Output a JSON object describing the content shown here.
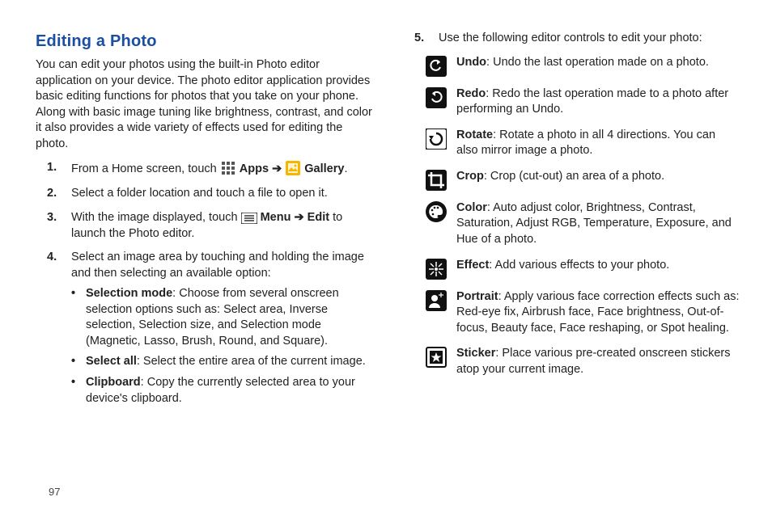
{
  "page_number": "97",
  "heading": "Editing a Photo",
  "intro": "You can edit your photos using the built-in Photo editor application on your device. The photo editor application provides basic editing functions for photos that you take on your phone. Along with basic image tuning like brightness, contrast, and color it also provides a wide variety of effects used for editing the photo.",
  "step1_pre": "From a Home screen, touch ",
  "step1_apps": "Apps",
  "step1_arrow": " ➔ ",
  "step1_gallery": "Gallery",
  "step1_post": ".",
  "step2": "Select a folder location and touch a file to open it.",
  "step3_pre": "With the image displayed, touch ",
  "step3_menu": "Menu",
  "step3_arrow": " ➔ ",
  "step3_edit": "Edit",
  "step3_post": " to launch the Photo editor.",
  "step4": "Select an image area by touching and holding the image and then selecting an available option:",
  "bullets": {
    "sel_mode_label": "Selection mode",
    "sel_mode_text": ": Choose from several onscreen selection options such as: Select area, Inverse selection, Selection size, and Selection mode (Magnetic, Lasso, Brush, Round, and Square).",
    "sel_all_label": "Select all",
    "sel_all_text": ": Select the entire area of the current image.",
    "clip_label": "Clipboard",
    "clip_text": ": Copy the currently selected area to your device's clipboard."
  },
  "step5": "Use the following editor controls to edit your photo:",
  "controls": {
    "undo_label": "Undo",
    "undo_text": ": Undo the last operation made on a photo.",
    "redo_label": "Redo",
    "redo_text": ": Redo the last operation made to a photo after performing an Undo.",
    "rotate_label": "Rotate",
    "rotate_text": ": Rotate a photo in all 4 directions. You can also mirror image a photo.",
    "crop_label": "Crop",
    "crop_text": ": Crop (cut-out) an area of a photo.",
    "color_label": "Color",
    "color_text": ":  Auto adjust color, Brightness, Contrast, Saturation, Adjust RGB, Temperature, Exposure, and Hue of a photo.",
    "effect_label": "Effect",
    "effect_text": ": Add various effects to your photo.",
    "portrait_label": "Portrait",
    "portrait_text": ": Apply various face correction effects such as: Red-eye fix, Airbrush face, Face brightness, Out-of-focus, Beauty face, Face reshaping, or Spot healing.",
    "sticker_label": "Sticker",
    "sticker_text": ": Place various pre-created onscreen stickers atop your current image."
  }
}
